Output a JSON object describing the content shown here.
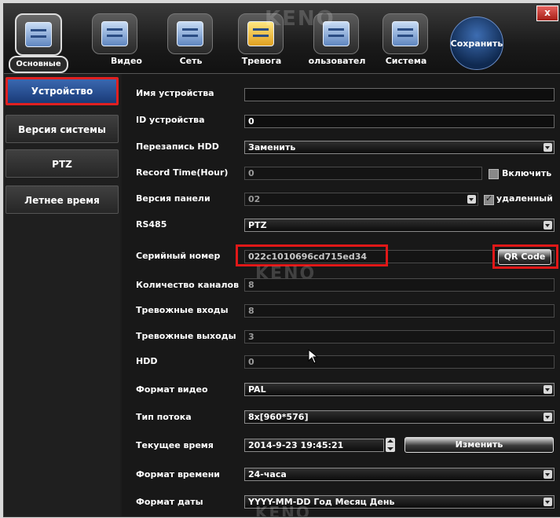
{
  "toolbar": {
    "tabs": [
      {
        "label": "Основные",
        "icon": "settings-list-icon"
      },
      {
        "label": "Видео",
        "icon": "video-camera-icon"
      },
      {
        "label": "Сеть",
        "icon": "network-icon"
      },
      {
        "label": "Тревога",
        "icon": "alarm-icon"
      },
      {
        "label": "ользовател",
        "icon": "user-icon"
      },
      {
        "label": "Система",
        "icon": "system-icon"
      }
    ],
    "save_label": "Сохранить",
    "close_label": "x"
  },
  "watermark": "KENO",
  "sidebar": {
    "items": [
      {
        "label": "Устройство"
      },
      {
        "label": "Версия системы"
      },
      {
        "label": "PTZ"
      },
      {
        "label": "Летнее время"
      }
    ]
  },
  "form": {
    "device_name": {
      "label": "Имя устройства",
      "value": ""
    },
    "device_id": {
      "label": "ID устройства",
      "value": "0"
    },
    "hdd_overwrite": {
      "label": "Перезапись HDD",
      "value": "Заменить"
    },
    "record_time": {
      "label": "Record Time(Hour)",
      "value": "0",
      "checkbox_label": "Включить"
    },
    "panel_version": {
      "label": "Версия панели",
      "value": "02",
      "checkbox_label": "удаленный"
    },
    "rs485": {
      "label": "RS485",
      "value": "PTZ"
    },
    "serial": {
      "label": "Серийный номер",
      "value": "022c1010696cd715ed34",
      "button_label": "QR Code"
    },
    "channels": {
      "label": "Количество каналов",
      "value": "8"
    },
    "alarm_in": {
      "label": "Тревожные входы",
      "value": "8"
    },
    "alarm_out": {
      "label": "Тревожные выходы",
      "value": "3"
    },
    "hdd": {
      "label": "HDD",
      "value": "0"
    },
    "video_format": {
      "label": "Формат видео",
      "value": "PAL"
    },
    "stream_type": {
      "label": "Тип потока",
      "value": "8x[960*576]"
    },
    "current_time": {
      "label": "Текущее время",
      "value": "2014-9-23 19:45:21",
      "button_label": "Изменить"
    },
    "time_format": {
      "label": "Формат времени",
      "value": "24-часа"
    },
    "date_format": {
      "label": "Формат даты",
      "value": "YYYY-MM-DD Год Месяц День"
    }
  }
}
